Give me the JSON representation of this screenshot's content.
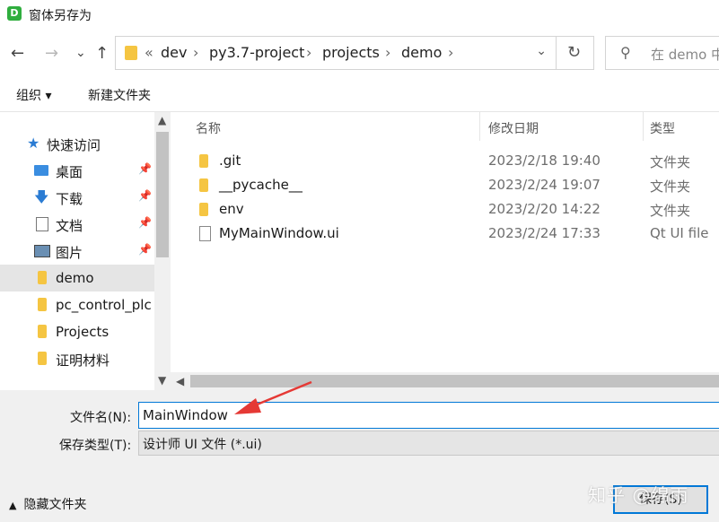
{
  "window": {
    "app_icon_letter": "D",
    "title": "窗体另存为"
  },
  "nav": {
    "back": "←",
    "forward": "→",
    "recent": "⌄",
    "up": "↑",
    "crumb_overflow": "«",
    "breadcrumb": [
      "dev",
      "py3.7-project",
      "projects",
      "demo"
    ],
    "separator": "›",
    "dropdown": "⌄",
    "refresh": "↻",
    "search_placeholder": "在 demo 中"
  },
  "toolbar": {
    "organize_label": "组织 ▾",
    "new_folder_label": "新建文件夹"
  },
  "sidebar": {
    "items": [
      {
        "label": "快速访问",
        "icon": "star-icon",
        "pinned": false
      },
      {
        "label": "桌面",
        "icon": "desktop-icon",
        "pinned": true
      },
      {
        "label": "下载",
        "icon": "download-icon",
        "pinned": true
      },
      {
        "label": "文档",
        "icon": "document-icon",
        "pinned": true
      },
      {
        "label": "图片",
        "icon": "picture-icon",
        "pinned": true
      },
      {
        "label": "demo",
        "icon": "folder-icon",
        "pinned": false,
        "selected": true
      },
      {
        "label": "pc_control_plc",
        "icon": "folder-icon",
        "pinned": false
      },
      {
        "label": "Projects",
        "icon": "folder-icon",
        "pinned": false
      },
      {
        "label": "证明材料",
        "icon": "folder-icon",
        "pinned": false
      }
    ]
  },
  "filelist": {
    "columns": {
      "name": "名称",
      "modified": "修改日期",
      "type": "类型"
    },
    "rows": [
      {
        "name": ".git",
        "modified": "2023/2/18 19:40",
        "type": "文件夹",
        "kind": "folder"
      },
      {
        "name": "__pycache__",
        "modified": "2023/2/24 19:07",
        "type": "文件夹",
        "kind": "folder"
      },
      {
        "name": "env",
        "modified": "2023/2/20 14:22",
        "type": "文件夹",
        "kind": "folder"
      },
      {
        "name": "MyMainWindow.ui",
        "modified": "2023/2/24 17:33",
        "type": "Qt UI file",
        "kind": "file"
      }
    ]
  },
  "form": {
    "filename_label": "文件名(N):",
    "filename_value": "MainWindow",
    "filetype_label": "保存类型(T):",
    "filetype_value": "设计师 UI 文件 (*.ui)"
  },
  "footer": {
    "hide_folders": "隐藏文件夹",
    "save_label": "保存(S)",
    "watermark": "知乎 @绵雨"
  },
  "colors": {
    "accent": "#0078d7",
    "folder": "#f5c542",
    "annotation": "#e53935"
  }
}
